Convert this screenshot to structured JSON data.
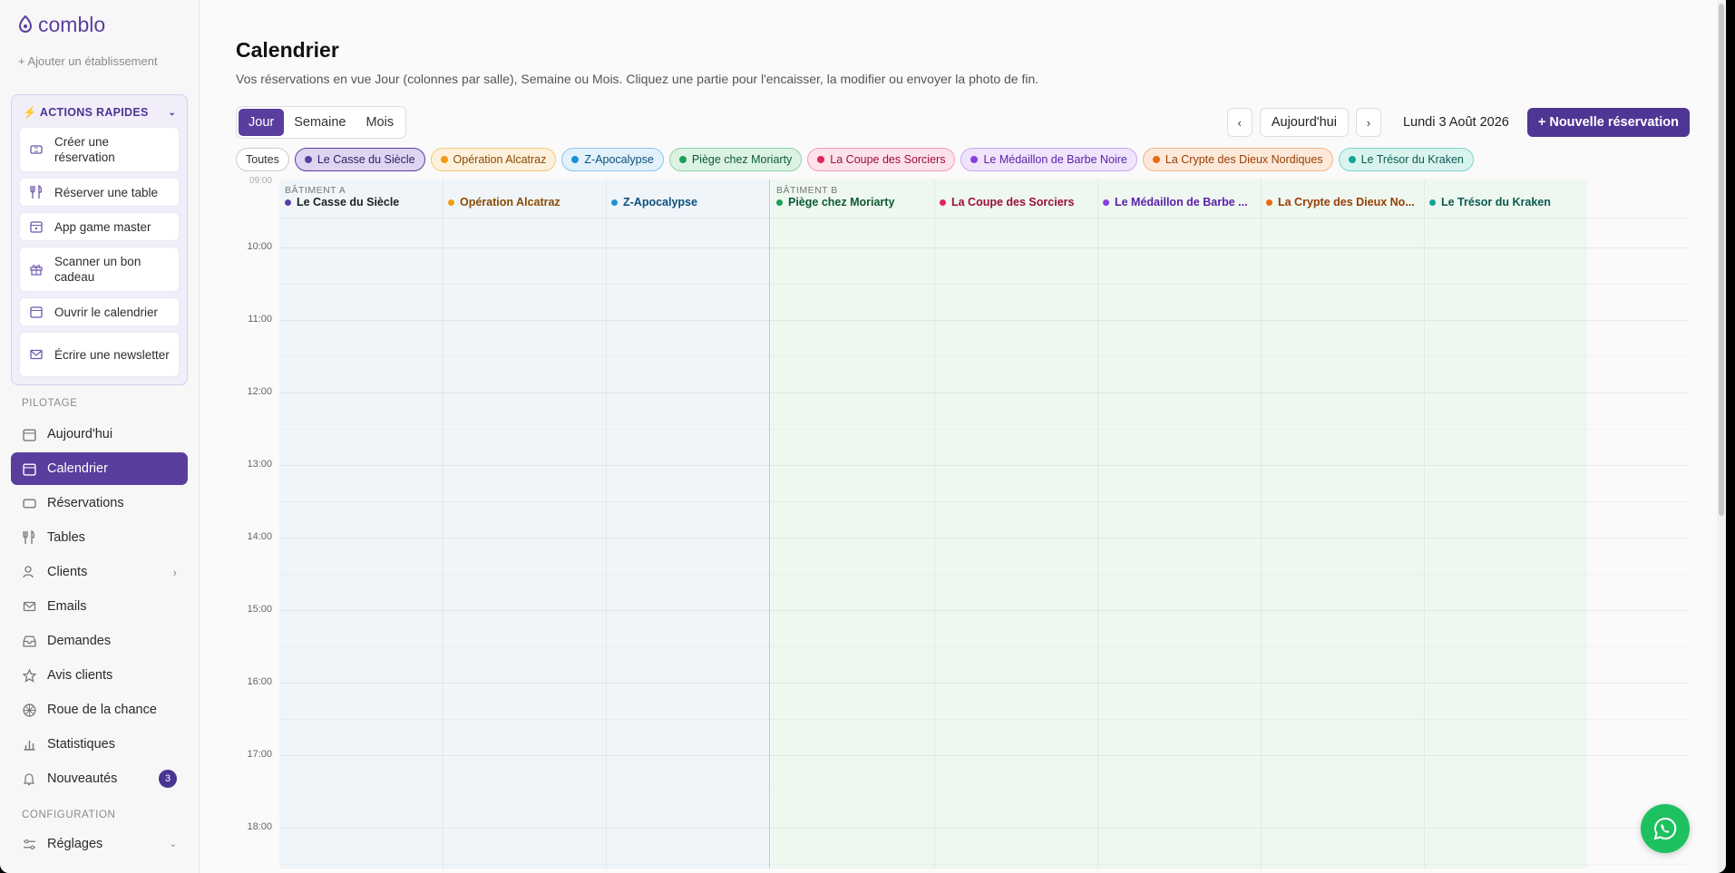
{
  "brand": {
    "name": "comblo"
  },
  "sidebar": {
    "add_estab": "+ Ajouter un établissement",
    "quick": {
      "title": "ACTIONS RAPIDES",
      "items": [
        {
          "label": "Créer une réservation",
          "icon": "ticket-icon"
        },
        {
          "label": "Réserver une table",
          "icon": "utensils-icon"
        },
        {
          "label": "App game master",
          "icon": "calendar-icon"
        },
        {
          "label": "Scanner un bon cadeau",
          "icon": "gift-icon"
        },
        {
          "label": "Ouvrir le calendrier",
          "icon": "calendar-icon"
        },
        {
          "label": "Écrire une newsletter",
          "icon": "mail-icon"
        }
      ]
    },
    "section_pilotage": "PILOTAGE",
    "nav": [
      {
        "label": "Aujourd'hui"
      },
      {
        "label": "Calendrier"
      },
      {
        "label": "Réservations"
      },
      {
        "label": "Tables"
      },
      {
        "label": "Clients"
      },
      {
        "label": "Emails"
      },
      {
        "label": "Demandes"
      },
      {
        "label": "Avis clients"
      },
      {
        "label": "Roue de la chance"
      },
      {
        "label": "Statistiques"
      },
      {
        "label": "Nouveautés",
        "badge": "3"
      }
    ],
    "section_config": "CONFIGURATION",
    "config": [
      {
        "label": "Réglages"
      }
    ]
  },
  "main": {
    "title": "Calendrier",
    "subtitle": "Vos réservations en vue Jour (colonnes par salle), Semaine ou Mois. Cliquez une partie pour l'encaisser, la modifier ou envoyer la photo de fin.",
    "views": [
      "Jour",
      "Semaine",
      "Mois"
    ],
    "prev": "‹",
    "next": "›",
    "today": "Aujourd'hui",
    "date": "Lundi 3 Août 2026",
    "new_btn": "+ Nouvelle réservation",
    "filter_all": "Toutes",
    "rooms": [
      {
        "name": "Le Casse du Siècle",
        "short": "Le Casse du Siècle",
        "color": "#5b3fa0",
        "bg": "#ddd5f2",
        "border": "#5b3fa0",
        "text": "#2d1f5e"
      },
      {
        "name": "Opération Alcatraz",
        "short": "Opération Alcatraz",
        "color": "#f39c12",
        "bg": "#fdf1dc",
        "border": "#f5c77a",
        "text": "#8a4b00"
      },
      {
        "name": "Z-Apocalypse",
        "short": "Z-Apocalypse",
        "color": "#1e90d6",
        "bg": "#e2f1fb",
        "border": "#8cc6ee",
        "text": "#0b4f7c"
      },
      {
        "name": "Piège chez Moriarty",
        "short": "Piège chez Moriarty",
        "color": "#1aa05a",
        "bg": "#dcf3e4",
        "border": "#8ed4a8",
        "text": "#0d5a30"
      },
      {
        "name": "La Coupe des Sorciers",
        "short": "La Coupe des Sorciers",
        "color": "#e0245e",
        "bg": "#fde2ea",
        "border": "#f3a0ba",
        "text": "#9b0f3c"
      },
      {
        "name": "Le Médaillon de Barbe Noire",
        "short": "Le Médaillon de Barbe ...",
        "color": "#8a3fe0",
        "bg": "#efe4fc",
        "border": "#c9a6f2",
        "text": "#5a1fa8"
      },
      {
        "name": "La Crypte des Dieux Nordiques",
        "short": "La Crypte des Dieux No...",
        "color": "#ea6a12",
        "bg": "#fde9da",
        "border": "#f4b585",
        "text": "#983d00"
      },
      {
        "name": "Le Trésor du Kraken",
        "short": "Le Trésor du Kraken",
        "color": "#12a594",
        "bg": "#d9f4ef",
        "border": "#7fd6c8",
        "text": "#0b5a50"
      }
    ],
    "building_a": "BÂTIMENT A",
    "building_b": "BÂTIMENT B",
    "hours": [
      "09:00",
      "10:00",
      "11:00",
      "12:00",
      "13:00",
      "14:00",
      "15:00",
      "16:00",
      "17:00",
      "18:00"
    ]
  }
}
